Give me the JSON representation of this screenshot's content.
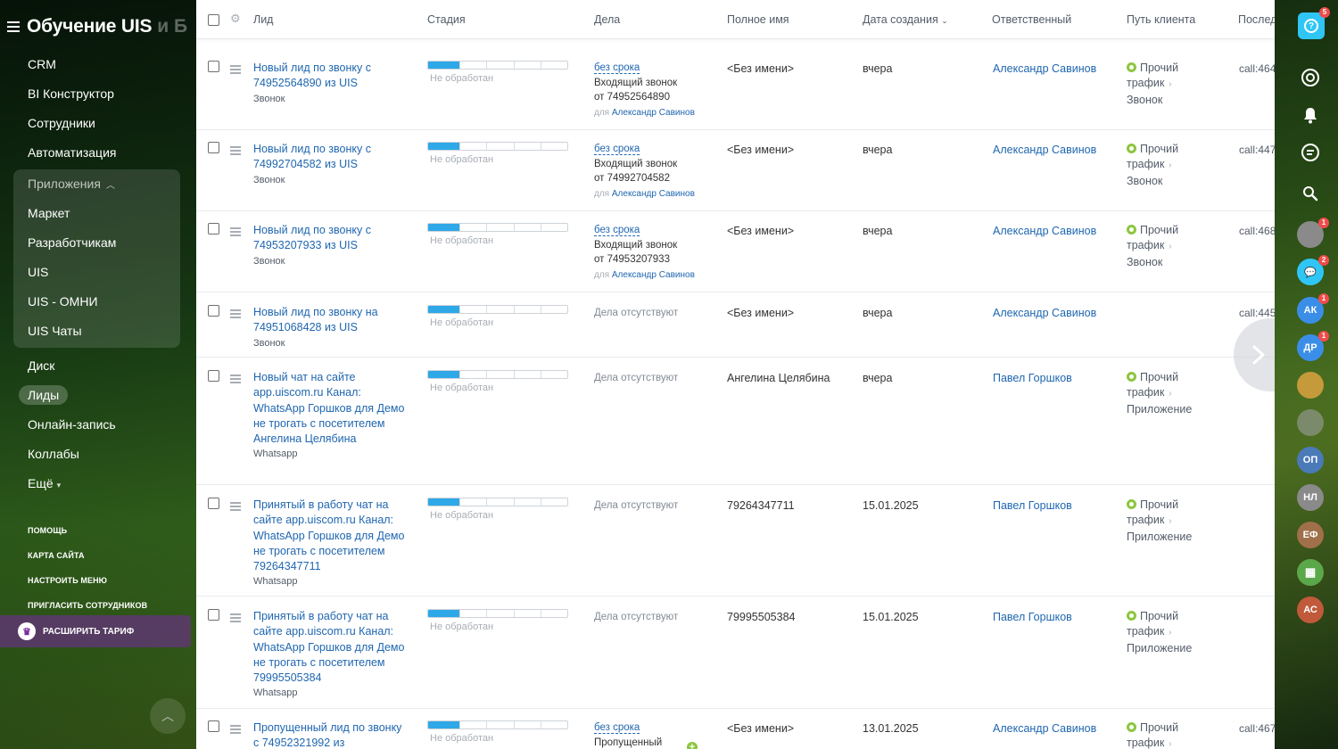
{
  "sidebar": {
    "title": "Обучение UIS",
    "title_suffix": "и Б",
    "items": [
      {
        "label": "CRM"
      },
      {
        "label": "BI Конструктор"
      },
      {
        "label": "Сотрудники"
      },
      {
        "label": "Автоматизация"
      }
    ],
    "group": {
      "label": "Приложения",
      "items": [
        {
          "label": "Маркет"
        },
        {
          "label": "Разработчикам"
        },
        {
          "label": "UIS"
        },
        {
          "label": "UIS - ОМНИ"
        },
        {
          "label": "UIS Чаты"
        }
      ]
    },
    "items2": [
      {
        "label": "Диск"
      },
      {
        "label": "Лиды",
        "active": true
      },
      {
        "label": "Онлайн-запись"
      },
      {
        "label": "Коллабы"
      },
      {
        "label": "Ещё"
      }
    ],
    "small_links": [
      "ПОМОЩЬ",
      "КАРТА САЙТА",
      "НАСТРОИТЬ МЕНЮ",
      "ПРИГЛАСИТЬ СОТРУДНИКОВ"
    ],
    "upgrade_label": "РАСШИРИТЬ ТАРИФ"
  },
  "table": {
    "columns": {
      "lead": "Лид",
      "stage": "Стадия",
      "deals": "Дела",
      "fullname": "Полное имя",
      "created": "Дата создания",
      "responsible": "Ответственный",
      "path": "Путь клиента",
      "last": "Послед"
    },
    "rows": [
      {
        "title": "Новый лид по звонку с 74952564890 из UIS",
        "source": "Звонок",
        "stage": "Не обработан",
        "deal_deadline": "без срока",
        "deal_text": "Входящий звонок",
        "deal_from": "от 74952564890",
        "deal_for_label": "для",
        "deal_for": "Александр Савинов",
        "name": "<Без имени>",
        "date": "вчера",
        "responsible": "Александр Савинов",
        "path1": "Прочий",
        "path2": "трафик",
        "path3": "Звонок",
        "last": "call:464"
      },
      {
        "title": "Новый лид по звонку с 74992704582 из UIS",
        "source": "Звонок",
        "stage": "Не обработан",
        "deal_deadline": "без срока",
        "deal_text": "Входящий звонок",
        "deal_from": "от 74992704582",
        "deal_for_label": "для",
        "deal_for": "Александр Савинов",
        "name": "<Без имени>",
        "date": "вчера",
        "responsible": "Александр Савинов",
        "path1": "Прочий",
        "path2": "трафик",
        "path3": "Звонок",
        "last": "call:447"
      },
      {
        "title": "Новый лид по звонку с 74953207933 из UIS",
        "source": "Звонок",
        "stage": "Не обработан",
        "deal_deadline": "без срока",
        "deal_text": "Входящий звонок",
        "deal_from": "от 74953207933",
        "deal_for_label": "для",
        "deal_for": "Александр Савинов",
        "name": "<Без имени>",
        "date": "вчера",
        "responsible": "Александр Савинов",
        "path1": "Прочий",
        "path2": "трафик",
        "path3": "Звонок",
        "last": "call:468"
      },
      {
        "title": "Новый лид по звонку на 74951068428 из UIS",
        "source": "Звонок",
        "stage": "Не обработан",
        "deal_none": "Дела отсутствуют",
        "name": "<Без имени>",
        "date": "вчера",
        "responsible": "Александр Савинов",
        "last": "call:445"
      },
      {
        "title": "Новый чат на сайте app.uiscom.ru Канал: WhatsApp Горшков для Демо не трогать с посетителем Ангелина Целябина",
        "source": "Whatsapp",
        "stage": "Не обработан",
        "deal_none": "Дела отсутствуют",
        "name": "Ангелина Целябина",
        "date": "вчера",
        "responsible": "Павел Горшков",
        "path1": "Прочий",
        "path2": "трафик",
        "path3": "Приложение"
      },
      {
        "title": "Принятый в работу чат на сайте app.uiscom.ru Канал: WhatsApp Горшков для Демо не трогать с посетителем 79264347711",
        "source": "Whatsapp",
        "stage": "Не обработан",
        "deal_none": "Дела отсутствуют",
        "name": "79264347711",
        "date": "15.01.2025",
        "responsible": "Павел Горшков",
        "path1": "Прочий",
        "path2": "трафик",
        "path3": "Приложение"
      },
      {
        "title": "Принятый в работу чат на сайте app.uiscom.ru Канал: WhatsApp Горшков для Демо не трогать с посетителем 79995505384",
        "source": "Whatsapp",
        "stage": "Не обработан",
        "deal_none": "Дела отсутствуют",
        "name": "79995505384",
        "date": "15.01.2025",
        "responsible": "Павел Горшков",
        "path1": "Прочий",
        "path2": "трафик",
        "path3": "Приложение"
      },
      {
        "title": "Пропущенный лид по звонку с 74952321992 из",
        "source": "",
        "stage": "Не обработан",
        "deal_deadline": "без срока",
        "deal_text": "Пропущенный",
        "name": "<Без имени>",
        "date": "13.01.2025",
        "responsible": "Александр Савинов",
        "path1": "Прочий",
        "path2": "трафик",
        "last": "call:467"
      }
    ]
  },
  "rightbar": {
    "help_badge": "5",
    "avatars": [
      {
        "initials": "",
        "badge": "1",
        "color": "#8a8a8a"
      },
      {
        "initials": "",
        "badge": "2",
        "color": "#2fc6f6"
      },
      {
        "initials": "АК",
        "badge": "1",
        "color": "#3b8ee8"
      },
      {
        "initials": "ДР",
        "badge": "1",
        "color": "#3b8ee8"
      },
      {
        "initials": "",
        "badge": "",
        "color": "#c49a3a"
      },
      {
        "initials": "",
        "badge": "",
        "color": "#7a8a6a"
      },
      {
        "initials": "ОП",
        "badge": "",
        "color": "#4a7ab8"
      },
      {
        "initials": "НЛ",
        "badge": "",
        "color": "#8a8a8a"
      },
      {
        "initials": "ЕФ",
        "badge": "",
        "color": "#a0704a"
      },
      {
        "initials": "",
        "badge": "",
        "color": "#5aa84a"
      },
      {
        "initials": "АС",
        "badge": "",
        "color": "#c05a3a"
      }
    ]
  }
}
